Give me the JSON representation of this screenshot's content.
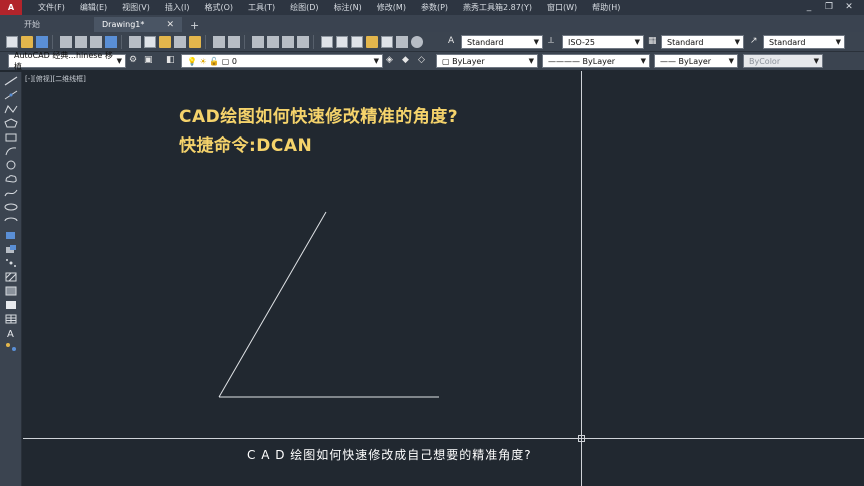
{
  "app": {
    "logo": "A",
    "menus": [
      "文件(F)",
      "编辑(E)",
      "视图(V)",
      "插入(I)",
      "格式(O)",
      "工具(T)",
      "绘图(D)",
      "标注(N)",
      "修改(M)",
      "参数(P)",
      "燕秀工具箱2.87(Y)",
      "窗口(W)",
      "帮助(H)"
    ],
    "window_controls": [
      "_",
      "❐",
      "✕"
    ]
  },
  "tabs": {
    "start": "开始",
    "active": "Drawing1*",
    "close": "✕",
    "add": "+"
  },
  "toolbar1": {
    "text_style": "Standard",
    "dim_style": "ISO-25",
    "table_style": "Standard",
    "multileader_style": "Standard"
  },
  "toolbar2": {
    "workspace": "AutoCAD 经典...hinese 移植",
    "layer": "0",
    "color": "ByLayer",
    "linetype": "ByLayer",
    "lineweight": "ByLayer",
    "plot_style": "ByColor"
  },
  "canvas": {
    "viewport_label": "[-][俯视][二维线框]",
    "title_line1": "CAD绘图如何快速修改精准的角度?",
    "title_line2": "快捷命令:DCAN",
    "subtitle": "C A D 绘图如何快速修改成自己想要的精准角度?"
  },
  "colors": {
    "background": "#212830",
    "title": "#f5d36b",
    "line": "#e0e3e6",
    "ui_dark": "#3b4450"
  }
}
